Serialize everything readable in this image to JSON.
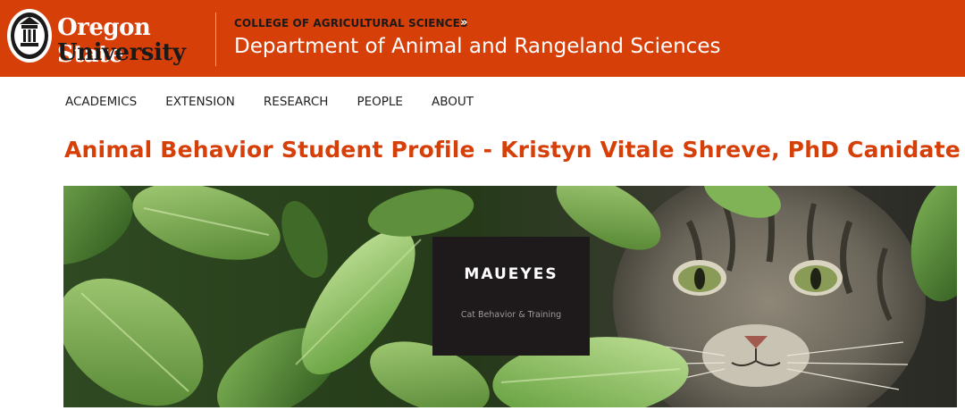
{
  "header": {
    "logo": {
      "line1": "Oregon State",
      "line2": "University",
      "seal_icon": "osu-seal-icon"
    },
    "college_link": "COLLEGE OF AGRICULTURAL SCIENCES",
    "college_arrow": "»",
    "department_title": "Department of Animal and Rangeland Sciences",
    "colors": {
      "brand": "#d73f09"
    }
  },
  "nav": {
    "items": [
      {
        "label": "ACADEMICS"
      },
      {
        "label": "EXTENSION"
      },
      {
        "label": "RESEARCH"
      },
      {
        "label": "PEOPLE"
      },
      {
        "label": "ABOUT"
      }
    ]
  },
  "page": {
    "title": "Animal Behavior Student Profile - Kristyn Vitale Shreve, PhD Canidate"
  },
  "hero": {
    "image_subject": "tabby cat peeking through green leaves",
    "card": {
      "title": "MAUEYES",
      "subtitle": "Cat Behavior & Training"
    }
  }
}
